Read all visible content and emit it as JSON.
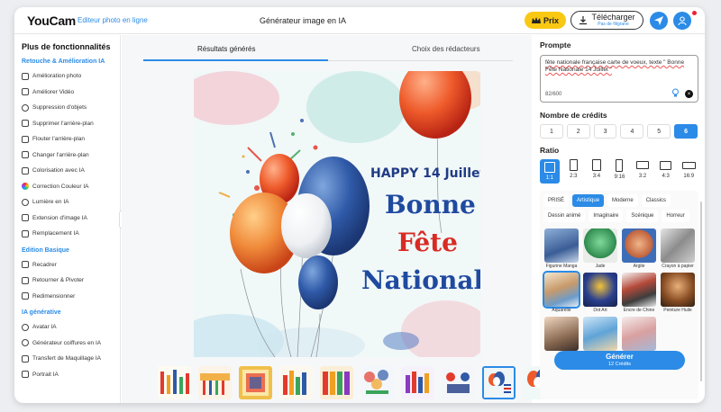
{
  "header": {
    "logo": "YouCam",
    "logo_sub": "Editeur photo en ligne",
    "title": "Générateur image en IA",
    "prix_label": "Prix",
    "download_label": "Télécharger",
    "download_sub": "Pas de filigrane",
    "icons": [
      "crown-icon",
      "download-icon",
      "send-icon",
      "user-icon"
    ],
    "accent": "#2b8be6",
    "prix_color": "#f9c813"
  },
  "sidebar": {
    "title": "Plus de fonctionnalités",
    "sections": [
      {
        "title": "Retouche & Amélioration IA",
        "items": [
          "Amélioration photo",
          "Améliorer Vidéo",
          "Suppression d'objets",
          "Supprimer l'arrière-plan",
          "Flouter l'arrière-plan",
          "Changer l'arrière-plan",
          "Colorisation avec IA",
          "Correction Couleur IA",
          "Lumière en IA",
          "Extension d'image IA",
          "Remplacement IA"
        ]
      },
      {
        "title": "Edition Basique",
        "items": [
          "Recadrer",
          "Retourner & Pivoter",
          "Redimensionner"
        ]
      },
      {
        "title": "IA générative",
        "items": [
          "Avatar IA",
          "Générateur coiffures en IA",
          "Transfert de Maquillage IA",
          "Portrait IA"
        ]
      }
    ]
  },
  "center": {
    "tabs": [
      "Résultats générés",
      "Choix des rédacteurs"
    ],
    "image_text": {
      "line1": "HAPPY 14 Juillet",
      "line2": "Bonne",
      "line3": "Fête",
      "line4": "Nationale"
    },
    "thumb_count": 10,
    "selected_thumb": 8
  },
  "right": {
    "prompt_label": "Prompte",
    "prompt_text": "fête nationale française carte de voeux, texte \" Bonne Fête Nationale 14 Juillet \"",
    "prompt_count": "82/600",
    "credits_label": "Nombre de crédits",
    "credits": [
      "1",
      "2",
      "3",
      "4",
      "5",
      "6"
    ],
    "selected_credit": "6",
    "ratio_label": "Ratio",
    "ratios": [
      "1:1",
      "2:3",
      "3:4",
      "9:16",
      "3:2",
      "4:3",
      "16:9"
    ],
    "selected_ratio": "1:1",
    "style_categories": [
      "PRISÉ",
      "Artistique",
      "Moderne",
      "Classics",
      "Dessin animé",
      "Imaginaire",
      "Scénique",
      "Horreur"
    ],
    "selected_category": "Artistique",
    "styles": [
      "Figurine Manga",
      "Jade",
      "Argile",
      "Crayon à papier",
      "Aquarelle",
      "Dot Art",
      "Encre de Chine",
      "Peinture Huile",
      "",
      "",
      ""
    ],
    "selected_style": "Aquarelle",
    "generate_label": "Générer",
    "generate_sub": "12 Crédits"
  }
}
